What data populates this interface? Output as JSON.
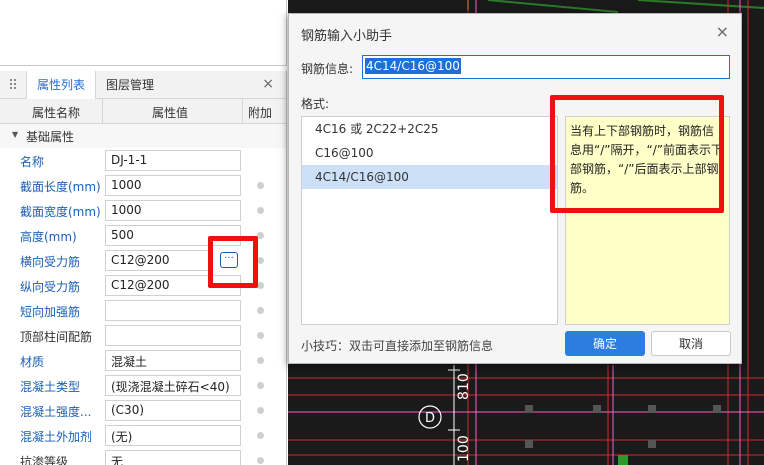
{
  "left_panel": {
    "tabs": [
      {
        "label": "属性列表",
        "active": true
      },
      {
        "label": "图层管理",
        "active": false
      }
    ],
    "close_symbol": "×",
    "columns": {
      "name": "属性名称",
      "value": "属性值",
      "extra": "附加"
    },
    "group": {
      "label": "基础属性"
    },
    "rows": [
      {
        "name": "名称",
        "value": "DJ-1-1",
        "name_color": "blue"
      },
      {
        "name": "截面长度(mm)",
        "value": "1000",
        "name_color": "blue"
      },
      {
        "name": "截面宽度(mm)",
        "value": "1000",
        "name_color": "blue"
      },
      {
        "name": "高度(mm)",
        "value": "500",
        "name_color": "blue"
      },
      {
        "name": "横向受力筋",
        "value": "C12@200",
        "name_color": "blue",
        "has_ellipsis": true
      },
      {
        "name": "纵向受力筋",
        "value": "C12@200",
        "name_color": "blue"
      },
      {
        "name": "短向加强筋",
        "value": "",
        "name_color": "blue"
      },
      {
        "name": "顶部柱间配筋",
        "value": "",
        "name_color": "dark"
      },
      {
        "name": "材质",
        "value": "混凝土",
        "name_color": "blue"
      },
      {
        "name": "混凝土类型",
        "value": "(现浇混凝土碎石<40)",
        "name_color": "blue"
      },
      {
        "name": "混凝土强度...",
        "value": "(C30)",
        "name_color": "blue"
      },
      {
        "name": "混凝土外加剂",
        "value": "(无)",
        "name_color": "blue"
      },
      {
        "name": "抗渗等级",
        "value": "无",
        "name_color": "dark"
      }
    ]
  },
  "dialog": {
    "title": "钢筋输入小助手",
    "close_symbol": "×",
    "info_label": "钢筋信息:",
    "info_value": "4C14/C16@100",
    "format_label": "格式:",
    "formats": [
      {
        "label": "4C16 或 2C22+2C25",
        "selected": false
      },
      {
        "label": "C16@100",
        "selected": false
      },
      {
        "label": "4C14/C16@100",
        "selected": true
      }
    ],
    "hint": "当有上下部钢筋时，钢筋信息用“/”隔开，“/”前面表示下部钢筋，“/”后面表示上部钢筋。",
    "tip": "小技巧：双击可直接添加至钢筋信息",
    "ok_label": "确定",
    "cancel_label": "取消"
  },
  "cad": {
    "axis_label": "D",
    "dim_text_1": "810",
    "dim_text_2": "100"
  },
  "colors": {
    "accent": "#1e6fd9",
    "highlight_red": "#f01010",
    "hint_bg": "#ffffc8",
    "cad_bg": "#1a1a1a"
  }
}
